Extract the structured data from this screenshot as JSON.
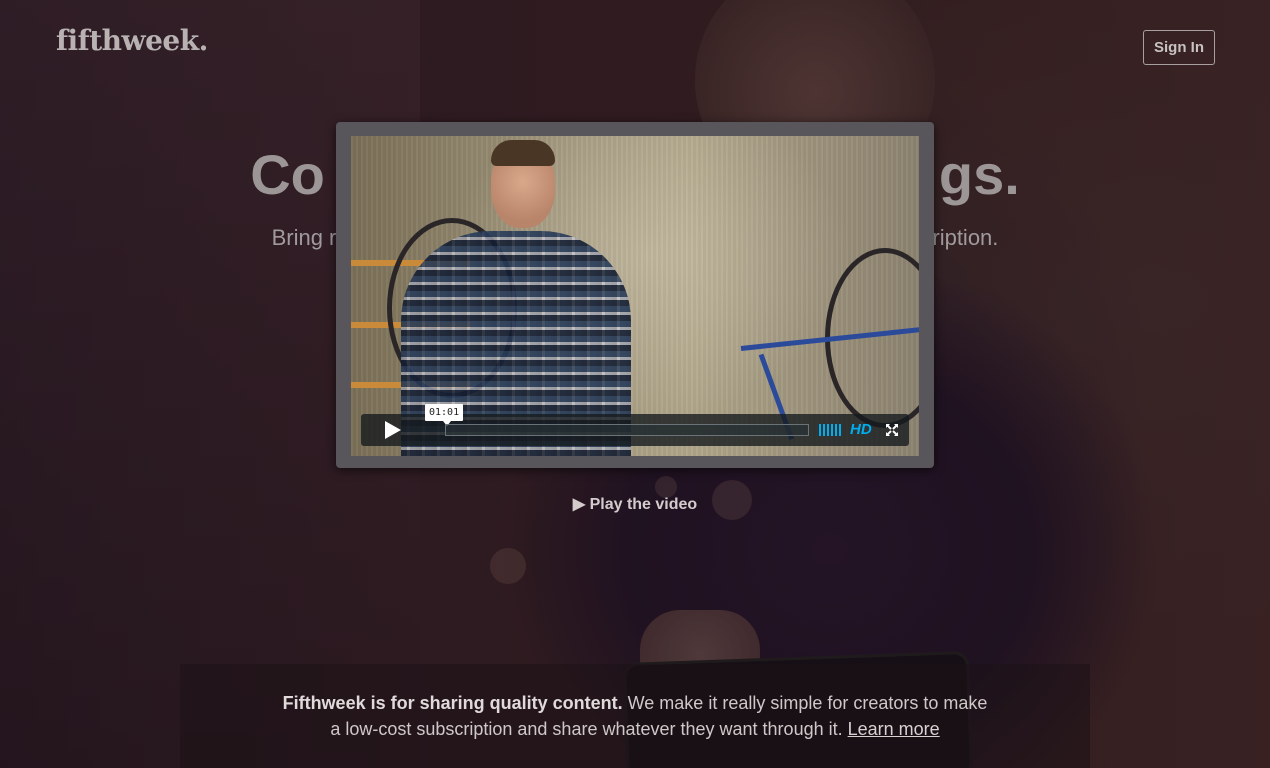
{
  "brand": {
    "logo": "fifthweek."
  },
  "header": {
    "signin_label": "Sign In"
  },
  "hero": {
    "headline_left": "Co",
    "headline_right": "gs.",
    "subhead_left": "Bring r",
    "subhead_right": "ription."
  },
  "video": {
    "timecode": "01:01",
    "progress": 0,
    "hd_label": "HD",
    "play_icon": "play-icon",
    "volume_icon": "volume-icon",
    "fullscreen_icon": "fullscreen-icon"
  },
  "cta": {
    "play_video": "▶ Play the video"
  },
  "footer": {
    "bold": "Fifthweek is for sharing quality content.",
    "line1": " We make it really simple for creators to make",
    "line2": "a low-cost subscription and share whatever they want through it. ",
    "learn_more": "Learn more"
  },
  "colors": {
    "accent": "#00adef",
    "modal_frame": "#58565a"
  }
}
